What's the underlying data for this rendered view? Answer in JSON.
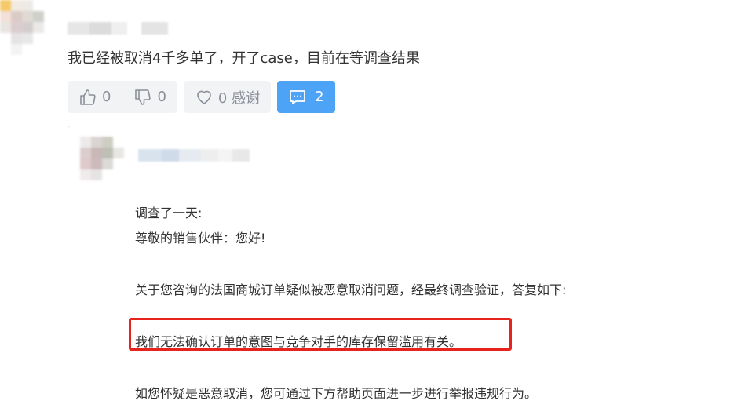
{
  "comment": {
    "text": "我已经被取消4千多单了，开了case，目前在等调查结果",
    "actions": {
      "like_count": "0",
      "dislike_count": "0",
      "thanks_label": "0 感谢",
      "reply_count": "2"
    }
  },
  "reply": {
    "lines": [
      "调查了一天:",
      "尊敬的销售伙伴：您好!",
      "关于您咨询的法国商城订单疑似被恶意取消问题，经最终调查验证，答复如下:",
      "我们无法确认订单的意图与竞争对手的库存保留滥用有关。",
      "如您怀疑是恶意取消，您可通过下方帮助页面进一步进行举报违规行为。"
    ]
  },
  "icons": {
    "like": "thumbs-up-icon",
    "dislike": "thumbs-down-icon",
    "thanks": "heart-icon",
    "reply": "comment-icon"
  },
  "colors": {
    "reply_button": "#4da3f5",
    "highlight_border": "#e8231e"
  }
}
